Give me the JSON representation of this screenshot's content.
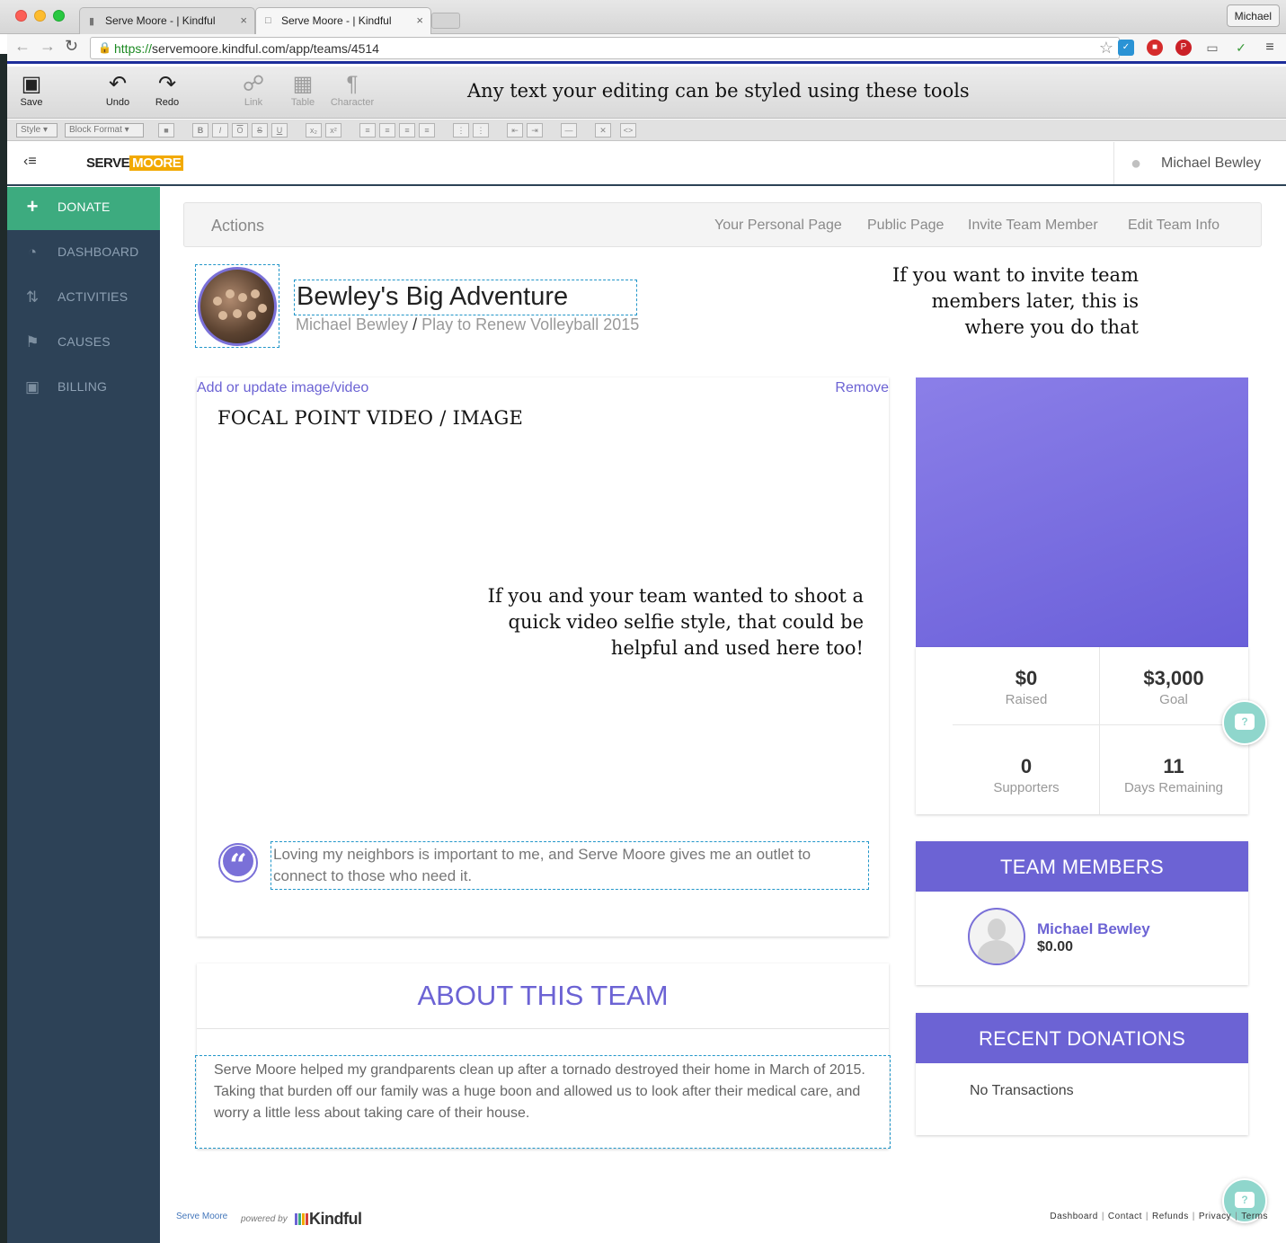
{
  "browser": {
    "tabs": [
      {
        "title": "Serve Moore - | Kindful"
      },
      {
        "title": "Serve Moore - | Kindful"
      }
    ],
    "profile_name": "Michael",
    "url_scheme": "https://",
    "url_rest": "servemoore.kindful.com/app/teams/4514"
  },
  "editor_toolbar": {
    "save": "Save",
    "undo": "Undo",
    "redo": "Redo",
    "link": "Link",
    "table": "Table",
    "character": "Character",
    "style_dropdown": "Style",
    "block_format_dropdown": "Block Format",
    "annotation": "Any text your editing can be styled using these tools"
  },
  "header": {
    "logo_part1": "SERVE",
    "logo_part2": "MOORE",
    "user_name": "Michael Bewley"
  },
  "sidebar": {
    "items": [
      {
        "label": "DONATE",
        "icon": "plus-icon"
      },
      {
        "label": "DASHBOARD",
        "icon": "gauge-icon"
      },
      {
        "label": "ACTIVITIES",
        "icon": "arrows-icon"
      },
      {
        "label": "CAUSES",
        "icon": "flag-icon"
      },
      {
        "label": "BILLING",
        "icon": "money-icon"
      }
    ]
  },
  "actions": {
    "title": "Actions",
    "links": [
      "Your Personal Page",
      "Public Page",
      "Invite Team Member",
      "Edit Team Info"
    ]
  },
  "team": {
    "name": "Bewley's Big Adventure",
    "owner": "Michael Bewley",
    "separator": "/",
    "campaign": "Play to Renew Volleyball 2015",
    "invite_note": "If you want to invite team members later, this is where you do that"
  },
  "focal": {
    "add_link": "Add or update image/video",
    "remove_link": "Remove",
    "heading": "FOCAL POINT VIDEO / IMAGE",
    "note": "If you and your team wanted to shoot a quick video selfie style, that could be helpful and used here too!",
    "quote": "Loving my neighbors is important to me, and Serve Moore gives me an outlet to connect to those who need it."
  },
  "about": {
    "title": "ABOUT THIS TEAM",
    "body": "Serve Moore helped my grandparents clean up after a tornado destroyed their home in March of 2015. Taking that burden off our family was a huge boon and allowed us to look after their medical care, and worry a little less about taking care of their house."
  },
  "stats": {
    "raised": {
      "value": "$0",
      "label": "Raised"
    },
    "goal": {
      "value": "$3,000",
      "label": "Goal"
    },
    "supporters": {
      "value": "0",
      "label": "Supporters"
    },
    "days": {
      "value": "11",
      "label": "Days Remaining"
    }
  },
  "team_members": {
    "title": "TEAM MEMBERS",
    "members": [
      {
        "name": "Michael Bewley",
        "amount": "$0.00"
      }
    ]
  },
  "recent_donations": {
    "title": "RECENT DONATIONS",
    "empty": "No Transactions"
  },
  "footer": {
    "brand": "Serve Moore",
    "powered_by": "powered by",
    "kindful": "Kindful",
    "links": [
      "Dashboard",
      "Contact",
      "Refunds",
      "Privacy",
      "Terms"
    ]
  },
  "colors": {
    "accent": "#6c63d4",
    "sidebar": "#2d4257",
    "donate": "#3dab7f",
    "logo_yellow": "#f2a900"
  }
}
